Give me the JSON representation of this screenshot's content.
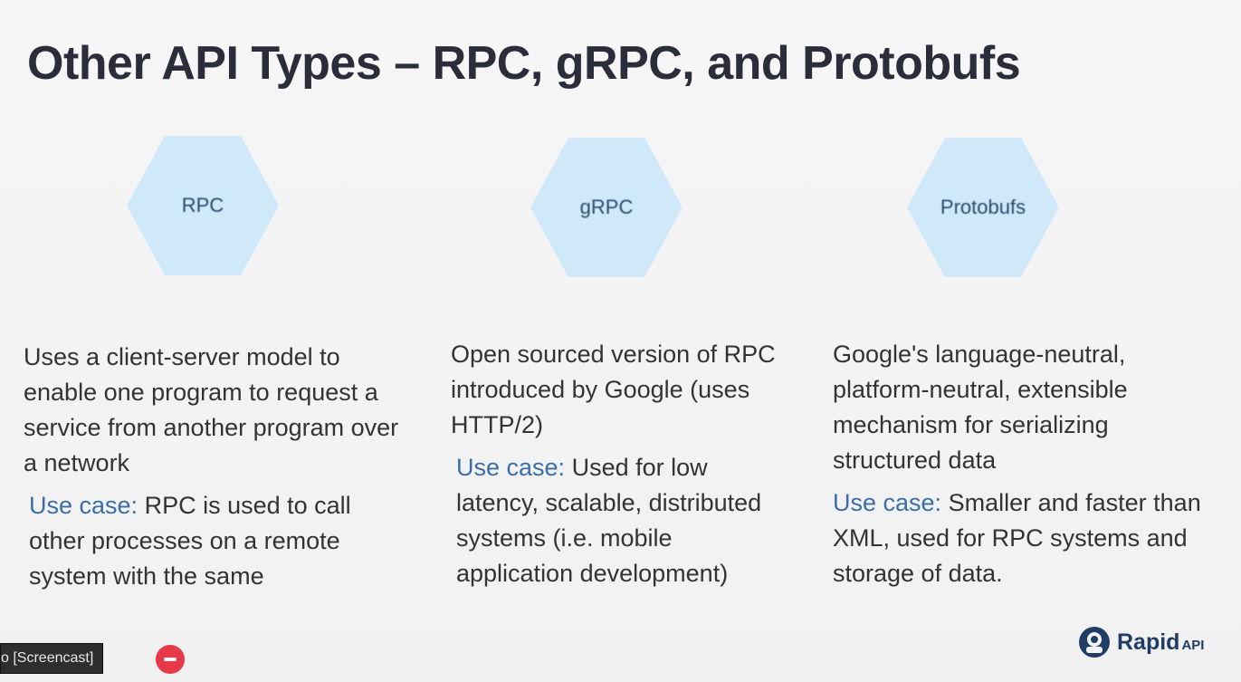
{
  "slide": {
    "title": "Other API Types – RPC, gRPC, and Protobufs",
    "columns": [
      {
        "heading": "RPC",
        "description": "Uses a client-server model to enable one program to request a service from another program over a network",
        "use_case_label": "Use case:",
        "use_case_text": " RPC is used to call other processes on a remote system with the same"
      },
      {
        "heading": "gRPC",
        "description": "Open sourced version of RPC introduced by Google (uses HTTP/2)",
        "use_case_label": "Use case:",
        "use_case_text": " Used for low latency, scalable, distributed systems (i.e. mobile application development)"
      },
      {
        "heading": "Protobufs",
        "description": "Google's language-neutral, platform-neutral, extensible mechanism for serializing structured data",
        "use_case_label": "Use case:",
        "use_case_text": " Smaller and faster than XML, used for RPC systems and storage of data."
      }
    ]
  },
  "overlay": {
    "recording_label": "o [Screencast]",
    "stop_icon": "stop-record-icon"
  },
  "brand": {
    "name": "Rapid",
    "suffix": "API",
    "icon": "rapidapi-logo-icon"
  },
  "colors": {
    "hex_fill": "#cfe9fb",
    "title": "#2b2d3a",
    "use_case_label": "#3b6ea8",
    "brand": "#1f3d66",
    "stop_button": "#e6394a"
  }
}
